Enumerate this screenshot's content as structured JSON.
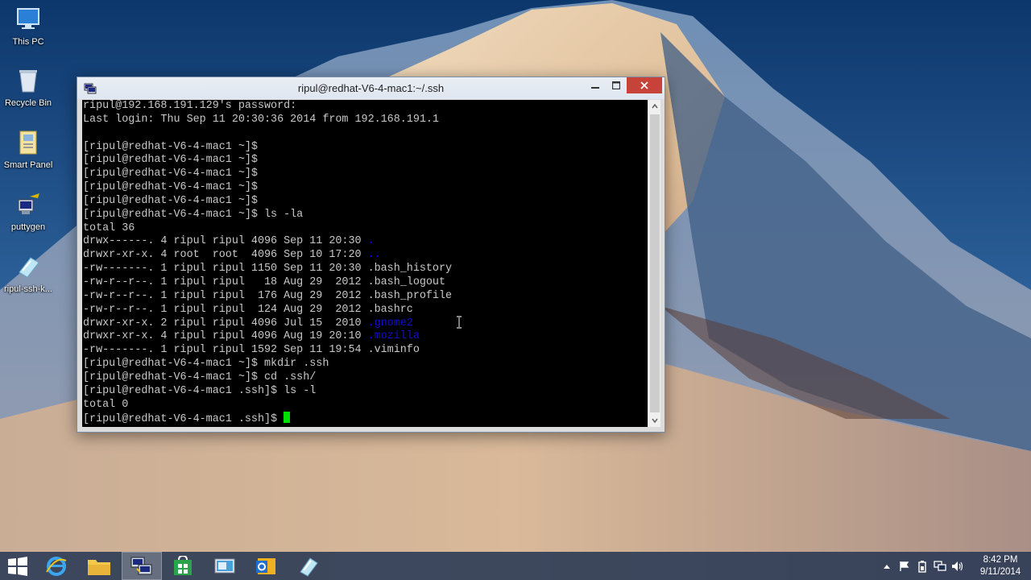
{
  "desktop": {
    "icons": [
      {
        "label": "This PC",
        "icon": "this-pc-icon"
      },
      {
        "label": "Recycle Bin",
        "icon": "recycle-bin-icon"
      },
      {
        "label": "Smart Panel",
        "icon": "smart-panel-icon"
      },
      {
        "label": "puttygen",
        "icon": "puttygen-icon"
      },
      {
        "label": "ripul-ssh-k...",
        "icon": "ssh-key-file-icon"
      }
    ]
  },
  "window": {
    "title": "ripul@redhat-V6-4-mac1:~/.ssh",
    "app_icon": "putty-icon"
  },
  "terminal": {
    "lines": [
      "ripul@192.168.191.129's password:",
      "Last login: Thu Sep 11 20:30:36 2014 from 192.168.191.1",
      "",
      "[ripul@redhat-V6-4-mac1 ~]$",
      "[ripul@redhat-V6-4-mac1 ~]$",
      "[ripul@redhat-V6-4-mac1 ~]$",
      "[ripul@redhat-V6-4-mac1 ~]$",
      "[ripul@redhat-V6-4-mac1 ~]$",
      "[ripul@redhat-V6-4-mac1 ~]$ ls -la",
      "total 36"
    ],
    "listing": [
      {
        "text": "drwx------. 4 ripul ripul 4096 Sep 11 20:30 ",
        "name": "."
      },
      {
        "text": "drwxr-xr-x. 4 root  root  4096 Sep 10 17:20 ",
        "name": ".."
      },
      {
        "text": "-rw-------. 1 ripul ripul 1150 Sep 11 20:30 ",
        "name": ".bash_history"
      },
      {
        "text": "-rw-r--r--. 1 ripul ripul   18 Aug 29  2012 ",
        "name": ".bash_logout"
      },
      {
        "text": "-rw-r--r--. 1 ripul ripul  176 Aug 29  2012 ",
        "name": ".bash_profile"
      },
      {
        "text": "-rw-r--r--. 1 ripul ripul  124 Aug 29  2012 ",
        "name": ".bashrc"
      },
      {
        "text": "drwxr-xr-x. 2 ripul ripul 4096 Jul 15  2010 ",
        "name": ".gnome2"
      },
      {
        "text": "drwxr-xr-x. 4 ripul ripul 4096 Aug 19 20:10 ",
        "name": ".mozilla"
      },
      {
        "text": "-rw-------. 1 ripul ripul 1592 Sep 11 19:54 ",
        "name": ".viminfo"
      }
    ],
    "tail_lines": [
      "[ripul@redhat-V6-4-mac1 ~]$ mkdir .ssh",
      "[ripul@redhat-V6-4-mac1 ~]$ cd .ssh/",
      "[ripul@redhat-V6-4-mac1 .ssh]$ ls -l",
      "total 0"
    ],
    "prompt": "[ripul@redhat-V6-4-mac1 .ssh]$ ",
    "dir_color": "#1010c8",
    "cursor_color": "#00e000"
  },
  "taskbar": {
    "items": [
      "start-icon",
      "internet-explorer-icon",
      "file-explorer-icon",
      "putty-icon",
      "store-icon",
      "remote-desktop-icon",
      "outlook-icon",
      "ssh-key-file-icon"
    ],
    "clock": {
      "time": "8:42 PM",
      "date": "9/11/2014"
    }
  }
}
